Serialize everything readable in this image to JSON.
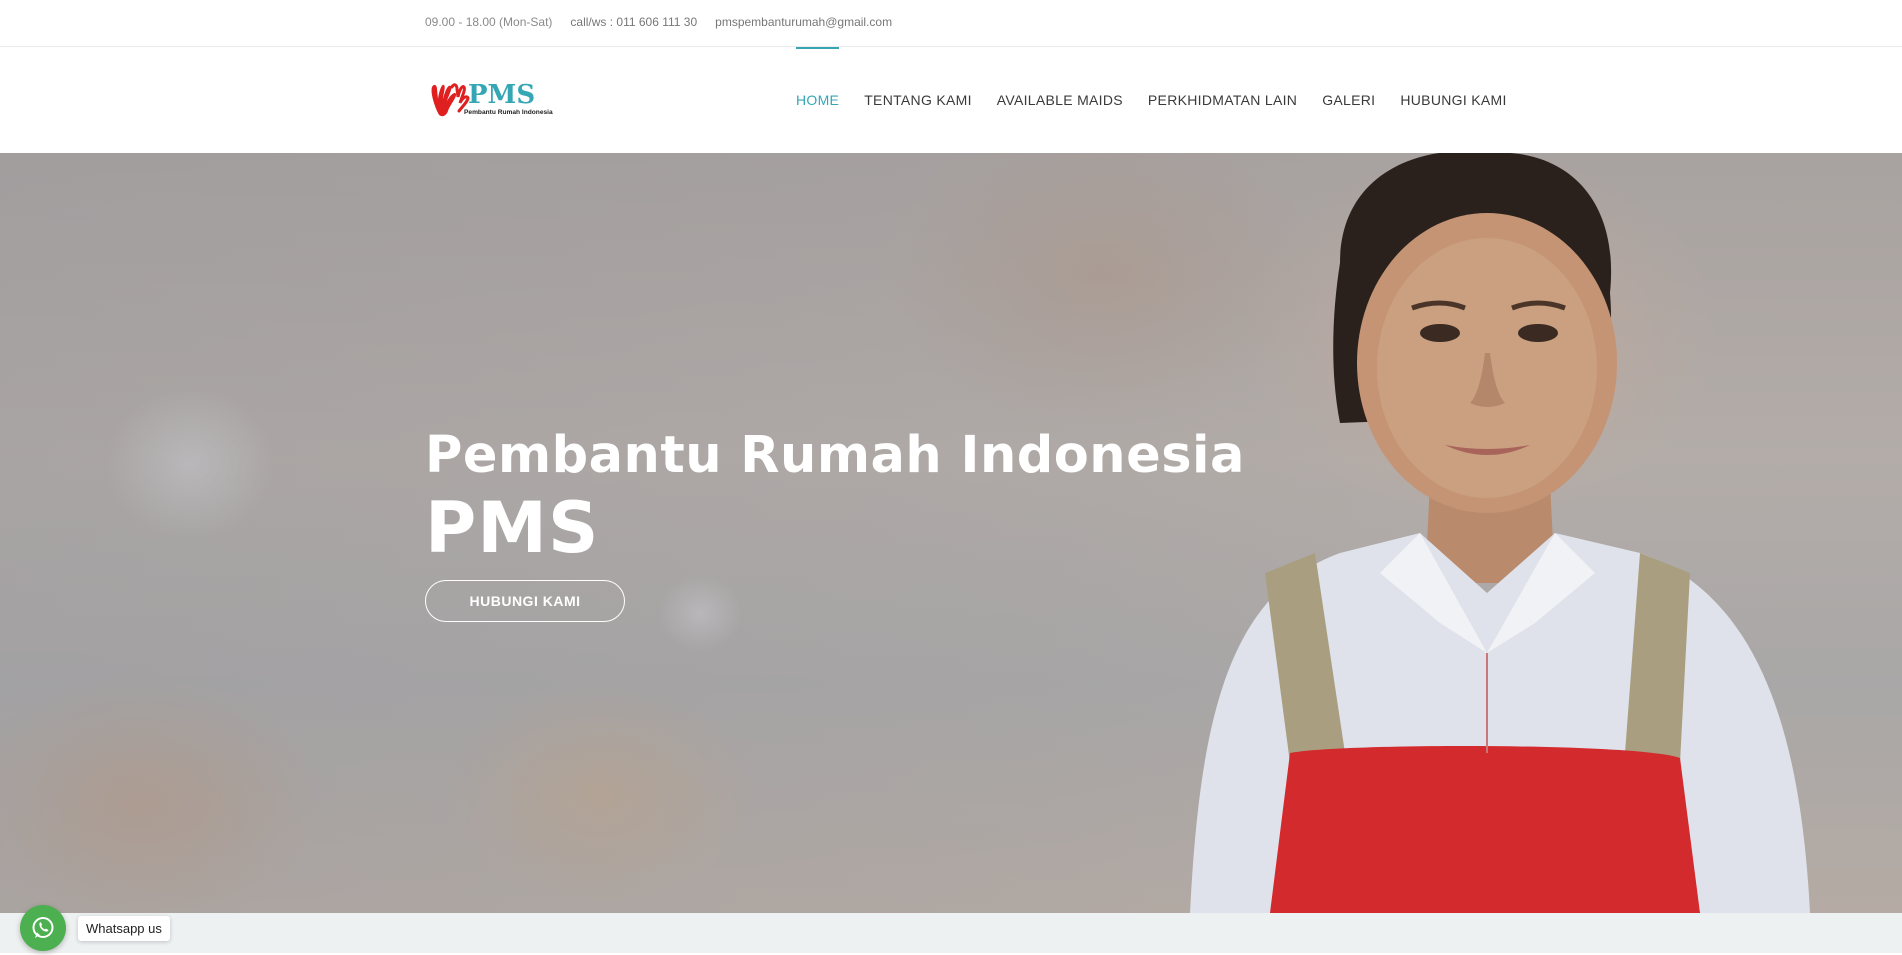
{
  "topbar": {
    "hours": "09.00 - 18.00 (Mon-Sat)",
    "phone": "call/ws : 011 606 111 30",
    "email": "pmspembanturumah@gmail.com"
  },
  "logo": {
    "brand": "PMS",
    "tagline": "Pembantu Rumah Indonesia"
  },
  "nav": {
    "items": [
      {
        "label": "HOME",
        "active": true
      },
      {
        "label": "TENTANG KAMI"
      },
      {
        "label": "AVAILABLE MAIDS"
      },
      {
        "label": "PERKHIDMATAN LAIN"
      },
      {
        "label": "GALERI"
      },
      {
        "label": "HUBUNGI KAMI"
      }
    ]
  },
  "hero": {
    "title_line1": "Pembantu Rumah Indonesia",
    "title_line2": "PMS",
    "cta_label": "HUBUNGI KAMI"
  },
  "whatsapp": {
    "label": "Whatsapp us",
    "icon": "whatsapp-icon"
  },
  "colors": {
    "accent": "#35a7b4",
    "logo_red": "#e02020",
    "whatsapp_green": "#4caf50"
  }
}
